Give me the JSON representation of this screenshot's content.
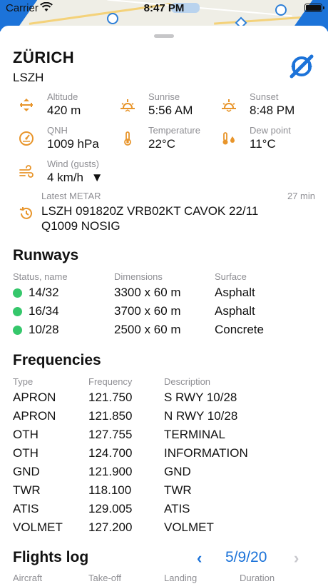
{
  "status": {
    "carrier": "Carrier",
    "time": "8:47 PM"
  },
  "colors": {
    "accent": "#1c73d9",
    "icon": "#e8952b",
    "runway_ok": "#35c76b",
    "secondary": "#8e8e93"
  },
  "airport": {
    "name": "ZÜRICH",
    "icao": "LSZH",
    "locate_icon": "navigation-target-icon"
  },
  "info": {
    "altitude": {
      "label": "Altitude",
      "value": "420 m"
    },
    "sunrise": {
      "label": "Sunrise",
      "value": "5:56 AM"
    },
    "sunset": {
      "label": "Sunset",
      "value": "8:48 PM"
    },
    "qnh": {
      "label": "QNH",
      "value": "1009 hPa"
    },
    "temperature": {
      "label": "Temperature",
      "value": "22°C"
    },
    "dew_point": {
      "label": "Dew point",
      "value": "11°C"
    },
    "wind": {
      "label": "Wind (gusts)",
      "value": "4 km/h",
      "arrow": "▼"
    }
  },
  "metar": {
    "label": "Latest METAR",
    "age": "27 min",
    "text": "LSZH 091820Z VRB02KT CAVOK 22/11 Q1009 NOSIG"
  },
  "runways": {
    "title": "Runways",
    "headers": [
      "Status, name",
      "Dimensions",
      "Surface"
    ],
    "rows": [
      {
        "name": "14/32",
        "dimensions": "3300 x 60 m",
        "surface": "Asphalt"
      },
      {
        "name": "16/34",
        "dimensions": "3700 x 60 m",
        "surface": "Asphalt"
      },
      {
        "name": "10/28",
        "dimensions": "2500 x 60 m",
        "surface": "Concrete"
      }
    ]
  },
  "frequencies": {
    "title": "Frequencies",
    "headers": [
      "Type",
      "Frequency",
      "Description"
    ],
    "rows": [
      {
        "type": "APRON",
        "freq": "121.750",
        "desc": "S RWY 10/28"
      },
      {
        "type": "APRON",
        "freq": "121.850",
        "desc": "N RWY 10/28"
      },
      {
        "type": "OTH",
        "freq": "127.755",
        "desc": "TERMINAL"
      },
      {
        "type": "OTH",
        "freq": "124.700",
        "desc": "INFORMATION"
      },
      {
        "type": "GND",
        "freq": "121.900",
        "desc": "GND"
      },
      {
        "type": "TWR",
        "freq": "118.100",
        "desc": "TWR"
      },
      {
        "type": "ATIS",
        "freq": "129.005",
        "desc": "ATIS"
      },
      {
        "type": "VOLMET",
        "freq": "127.200",
        "desc": "VOLMET"
      }
    ]
  },
  "flights_log": {
    "title": "Flights log",
    "prev": "‹",
    "date": "5/9/20",
    "next": "›",
    "headers": [
      "Aircraft",
      "Take-off",
      "Landing",
      "Duration"
    ]
  }
}
